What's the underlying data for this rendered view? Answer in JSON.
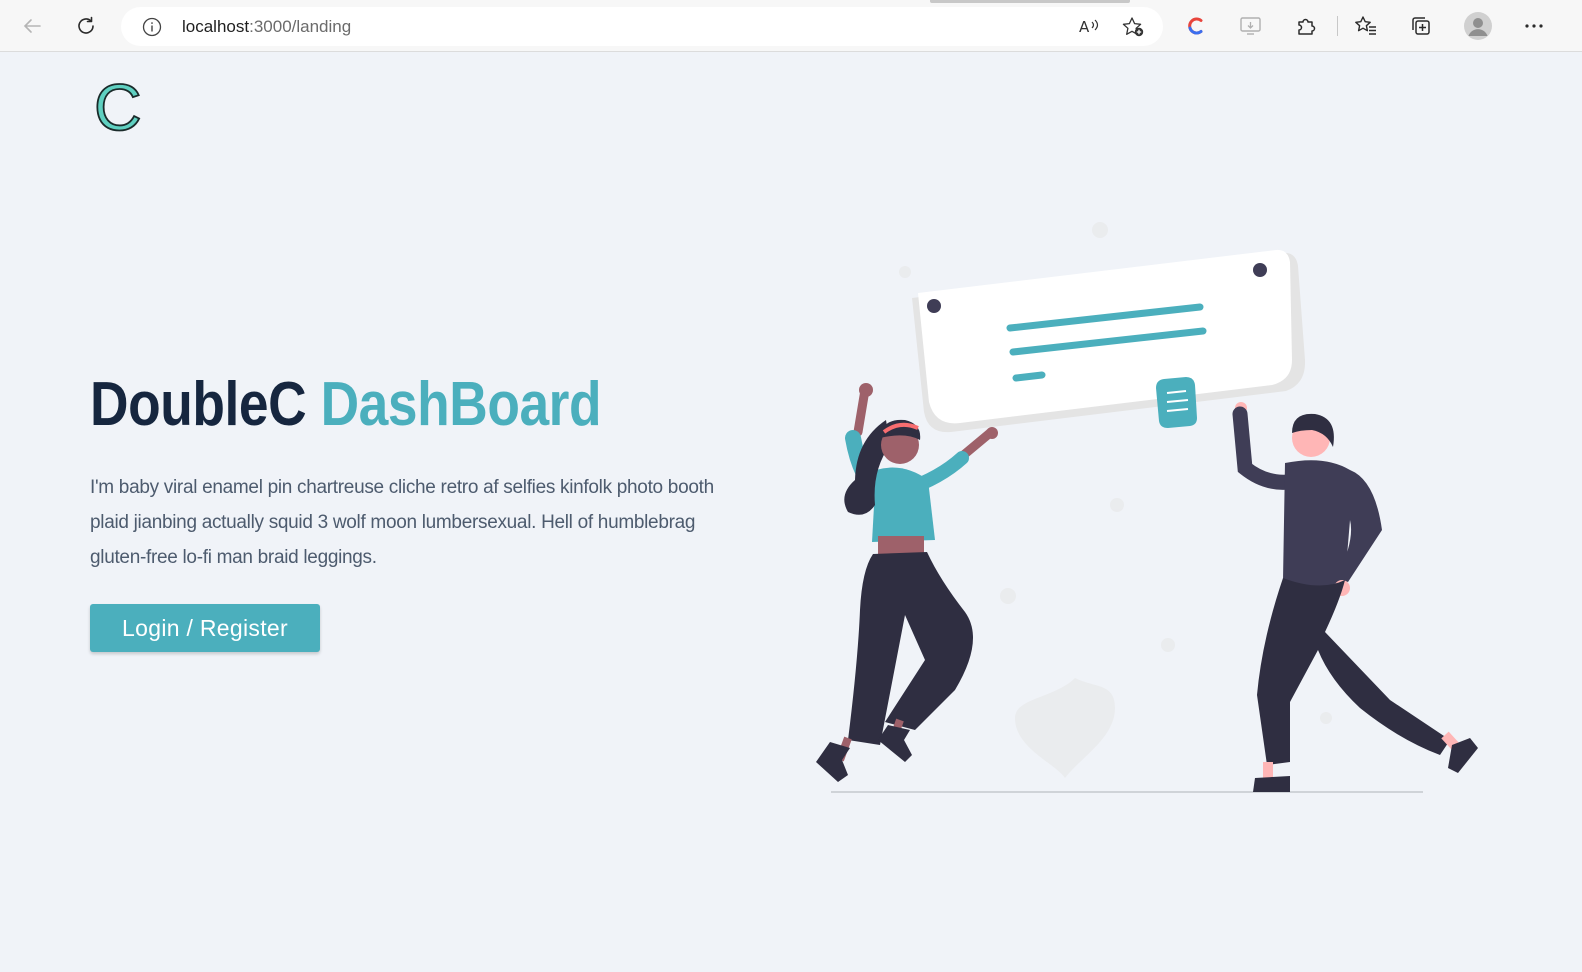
{
  "browser": {
    "url_host": "localhost",
    "url_path": ":3000/landing",
    "accent_colors": {
      "edge_logo_red": "#e8453c",
      "edge_logo_blue": "#3a6ff0"
    }
  },
  "icons": {
    "back": "back-arrow-icon",
    "reload": "reload-icon",
    "info": "info-icon",
    "read_aloud": "read-aloud-icon",
    "favorite_add": "add-favorite-icon",
    "extension_c": "c-extension-icon",
    "cast": "cast-icon",
    "extensions": "puzzle-icon",
    "favorites": "favorites-icon",
    "collections": "collections-icon",
    "profile": "profile-avatar-icon",
    "menu": "more-menu-icon"
  },
  "page": {
    "logo_letter": "C",
    "title_part1": "DoubleC",
    "title_part2": "DashBoard",
    "description": "I'm baby viral enamel pin chartreuse cliche retro af selfies kinfolk photo booth plaid jianbing actually squid 3 wolf moon lumbersexual. Hell of humblebrag gluten-free lo-fi man braid leggings.",
    "cta_label": "Login / Register",
    "colors": {
      "background": "#f0f3f8",
      "title_dark": "#16263f",
      "title_accent": "#4bafbd",
      "button": "#4bafbd",
      "logo_fill": "#5fd0c1",
      "illustration_dark": "#3f3d56",
      "illustration_skin_dark": "#9e616a",
      "illustration_skin_light": "#ffb6b6"
    }
  }
}
